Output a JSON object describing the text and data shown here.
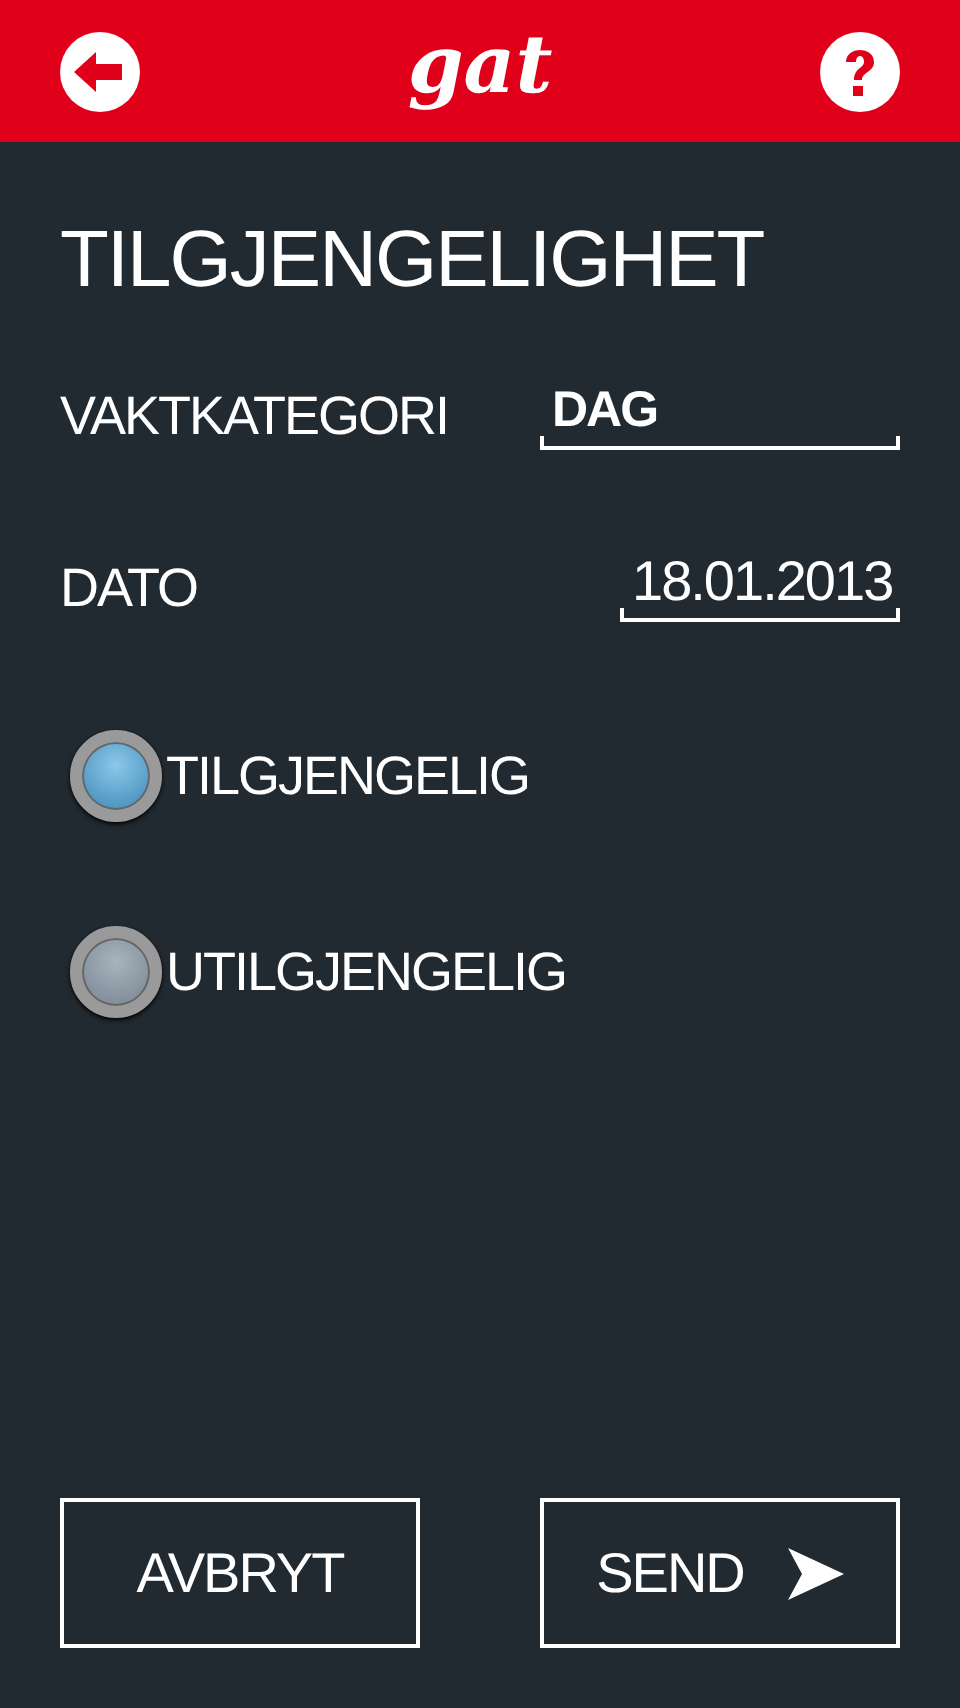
{
  "header": {
    "logo": "gat"
  },
  "title": "TILGJENGELIGHET",
  "fields": [
    {
      "label": "VAKTKATEGORI",
      "value": "DAG",
      "kind": "select"
    },
    {
      "label": "DATO",
      "value": "18.01.2013",
      "kind": "date"
    }
  ],
  "options": [
    {
      "label": "TILGJENGELIG",
      "selected": true
    },
    {
      "label": "UTILGJENGELIG",
      "selected": false
    }
  ],
  "buttons": [
    {
      "label": "AVBRYT",
      "kind": "cancel"
    },
    {
      "label": "SEND",
      "kind": "send"
    }
  ]
}
